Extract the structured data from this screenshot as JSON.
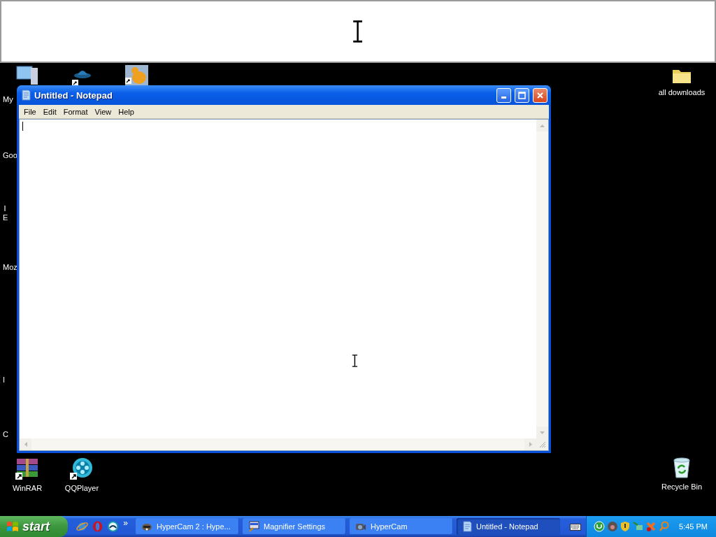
{
  "desktop": {
    "cut_labels": [
      "My",
      "Goo",
      "I E",
      "Moz",
      "I",
      "C"
    ],
    "icons": [
      {
        "label": "all downloads",
        "kind": "folder"
      },
      {
        "label": "WinRAR",
        "kind": "archive"
      },
      {
        "label": "QQPlayer",
        "kind": "player"
      },
      {
        "label": "Recycle Bin",
        "kind": "recycle"
      }
    ]
  },
  "window": {
    "title": "Untitled - Notepad",
    "active": true,
    "menu": [
      "File",
      "Edit",
      "Format",
      "View",
      "Help"
    ]
  },
  "taskbar": {
    "start": "start",
    "more": "»",
    "tasks": [
      {
        "label": "HyperCam 2 : Hype...",
        "kind": "hypercam2",
        "selected": false
      },
      {
        "label": "Magnifier Settings",
        "kind": "magnifier",
        "selected": false
      },
      {
        "label": "HyperCam",
        "kind": "camera",
        "selected": false
      },
      {
        "label": "Untitled - Notepad",
        "kind": "notepad",
        "selected": true
      }
    ],
    "clock": "5:45 PM"
  }
}
